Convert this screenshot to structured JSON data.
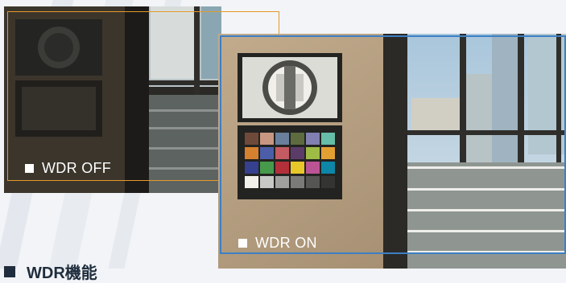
{
  "comparison": {
    "off_label": "WDR OFF",
    "on_label": "WDR ON"
  },
  "section": {
    "title": "WDR機能"
  },
  "colors": {
    "off_frame": "#e59a2a",
    "on_frame": "#3d7fc4",
    "background": "#f2f4f7"
  }
}
